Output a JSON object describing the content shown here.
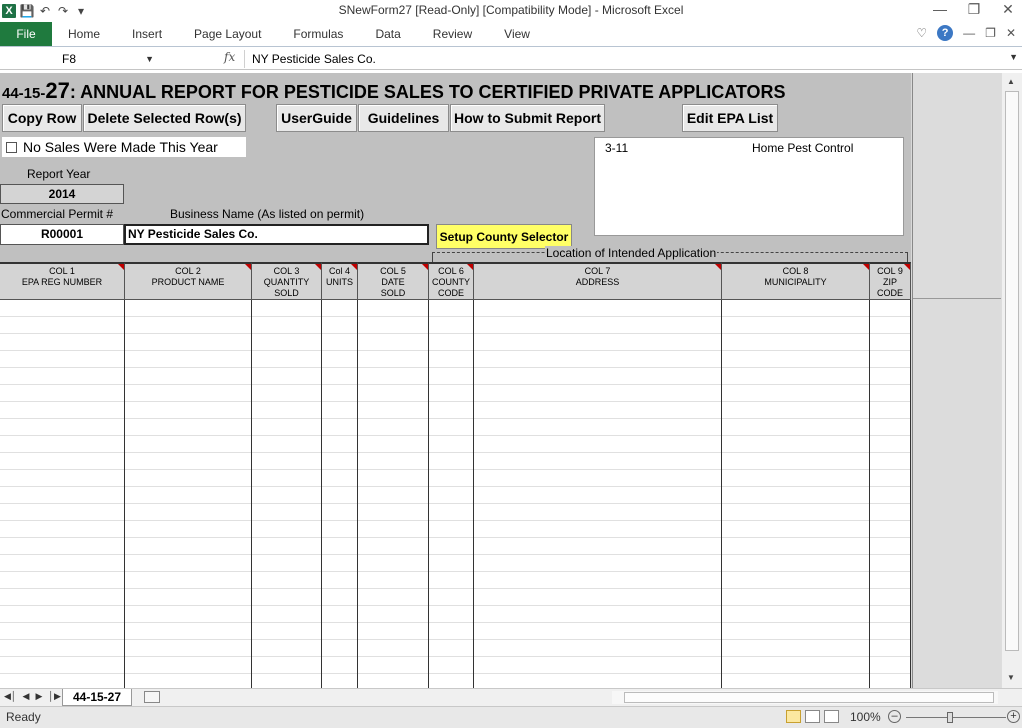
{
  "window": {
    "title": "SNewForm27  [Read-Only]  [Compatibility Mode]  -  Microsoft Excel"
  },
  "ribbon": {
    "file": "File",
    "tabs": [
      "Home",
      "Insert",
      "Page Layout",
      "Formulas",
      "Data",
      "Review",
      "View"
    ]
  },
  "formula_bar": {
    "cell_ref": "F8",
    "fx": "fx",
    "value": "NY Pesticide Sales Co."
  },
  "form": {
    "code_prefix": "44-15-",
    "code_number": "27",
    "title": ": ANNUAL REPORT FOR PESTICIDE SALES TO CERTIFIED PRIVATE APPLICATORS",
    "buttons": {
      "copy_row": "Copy Row",
      "delete_rows": "Delete Selected Row(s)",
      "user_guide": "UserGuide",
      "guidelines": "Guidelines",
      "how_to_submit": "How to Submit Report",
      "edit_epa": "Edit EPA List",
      "county_selector": "Setup County Selector"
    },
    "no_sales_label": "No Sales Were Made This Year",
    "report_year_label": "Report Year",
    "report_year": "2014",
    "permit_label": "Commercial Permit #",
    "permit_value": "R00001",
    "business_label": "Business Name (As listed on permit)",
    "business_value": "NY Pesticide Sales Co.",
    "location_label": "Location of Intended Application",
    "list": {
      "code": "3-11",
      "name": "Home Pest Control"
    }
  },
  "columns": [
    {
      "l1": "COL 1",
      "l2": "EPA REG NUMBER",
      "l3": ""
    },
    {
      "l1": "COL 2",
      "l2": "PRODUCT NAME",
      "l3": ""
    },
    {
      "l1": "COL 3",
      "l2": "QUANTITY",
      "l3": "SOLD"
    },
    {
      "l1": "Col 4",
      "l2": "UNITS",
      "l3": ""
    },
    {
      "l1": "COL 5",
      "l2": "DATE",
      "l3": "SOLD"
    },
    {
      "l1": "COL 6",
      "l2": "COUNTY",
      "l3": "CODE"
    },
    {
      "l1": "COL 7",
      "l2": "ADDRESS",
      "l3": ""
    },
    {
      "l1": "COL 8",
      "l2": "MUNICIPALITY",
      "l3": ""
    },
    {
      "l1": "COL 9",
      "l2": "ZIP",
      "l3": "CODE"
    }
  ],
  "sheet_tab": "44-15-27",
  "status": {
    "ready": "Ready",
    "zoom": "100%"
  }
}
